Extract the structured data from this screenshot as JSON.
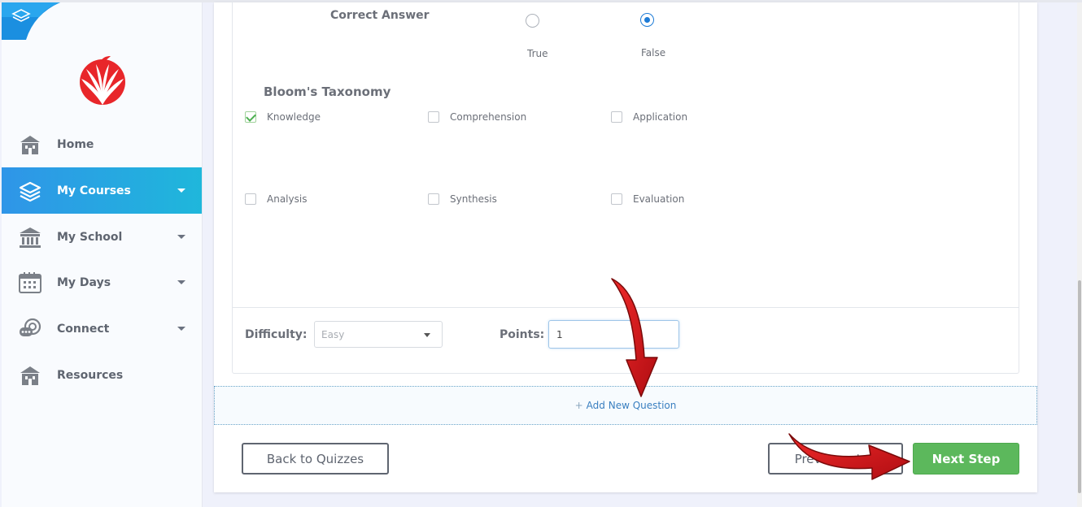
{
  "sidebar": {
    "items": [
      {
        "label": "Home",
        "icon": "home-icon",
        "has_caret": false
      },
      {
        "label": "My Courses",
        "icon": "layers-icon",
        "has_caret": true,
        "active": true
      },
      {
        "label": "My School",
        "icon": "school-icon",
        "has_caret": true
      },
      {
        "label": "My Days",
        "icon": "calendar-icon",
        "has_caret": true
      },
      {
        "label": "Connect",
        "icon": "chat-icon",
        "has_caret": true
      },
      {
        "label": "Resources",
        "icon": "resources-icon",
        "has_caret": false
      }
    ],
    "active_color": "#2f95e8"
  },
  "question": {
    "correct_answer_label": "Correct Answer",
    "options": [
      {
        "label": "True",
        "checked": false
      },
      {
        "label": "False",
        "checked": true
      }
    ]
  },
  "taxonomy": {
    "title": "Bloom's Taxonomy",
    "items": [
      {
        "label": "Knowledge",
        "checked": true
      },
      {
        "label": "Comprehension",
        "checked": false
      },
      {
        "label": "Application",
        "checked": false
      },
      {
        "label": "Analysis",
        "checked": false
      },
      {
        "label": "Synthesis",
        "checked": false
      },
      {
        "label": "Evaluation",
        "checked": false
      }
    ]
  },
  "settings": {
    "difficulty_label": "Difficulty:",
    "difficulty_value": "Easy",
    "points_label": "Points:",
    "points_value": "1"
  },
  "actions": {
    "add_question": "Add New Question",
    "add_question_prefix": "+",
    "back": "Back to Quizzes",
    "previous": "Previous step",
    "next": "Next Step"
  },
  "colors": {
    "next_button": "#5cb85c",
    "radio_selected": "#1d7bd6",
    "annotation_arrow": "#d0121b"
  }
}
